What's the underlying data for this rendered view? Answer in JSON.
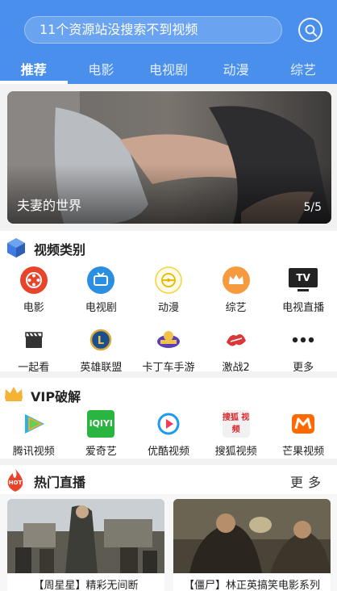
{
  "search": {
    "placeholder": "11个资源站没搜索不到视频"
  },
  "tabs": [
    "推荐",
    "电影",
    "电视剧",
    "动漫",
    "综艺"
  ],
  "banner": {
    "title": "夫妻的世界",
    "counter": "5/5"
  },
  "categories": {
    "title": "视频类别",
    "row1": [
      {
        "label": "电影",
        "icon": "film-reel-icon"
      },
      {
        "label": "电视剧",
        "icon": "tv-icon"
      },
      {
        "label": "动漫",
        "icon": "anime-icon"
      },
      {
        "label": "综艺",
        "icon": "crown-icon"
      },
      {
        "label": "电视直播",
        "icon": "tv-live-icon",
        "badge": "TV"
      }
    ],
    "row2": [
      {
        "label": "一起看",
        "icon": "clapperboard-icon"
      },
      {
        "label": "英雄联盟",
        "icon": "lol-logo-icon"
      },
      {
        "label": "卡丁车手游",
        "icon": "kart-logo-icon"
      },
      {
        "label": "激战2",
        "icon": "guild-wars-logo-icon"
      },
      {
        "label": "更多",
        "icon": "more-dots-icon"
      }
    ]
  },
  "vip": {
    "title": "VIP破解",
    "items": [
      {
        "label": "腾讯视频",
        "icon": "tencent-video-icon"
      },
      {
        "label": "爱奇艺",
        "icon": "iqiyi-icon",
        "badge": "iQIYI"
      },
      {
        "label": "优酷视频",
        "icon": "youku-icon"
      },
      {
        "label": "搜狐视频",
        "icon": "sohu-icon",
        "badge": "搜狐 视频"
      },
      {
        "label": "芒果视频",
        "icon": "mango-tv-icon"
      }
    ]
  },
  "live": {
    "title": "热门直播",
    "more_label": "更多",
    "hot_badge": "HOT",
    "cards": [
      {
        "caption": "【周星星】精彩无间断"
      },
      {
        "caption": "【僵尸】林正英搞笑电影系列"
      }
    ]
  },
  "colors": {
    "header": "#4a8fec",
    "accent": "#e8442b"
  }
}
